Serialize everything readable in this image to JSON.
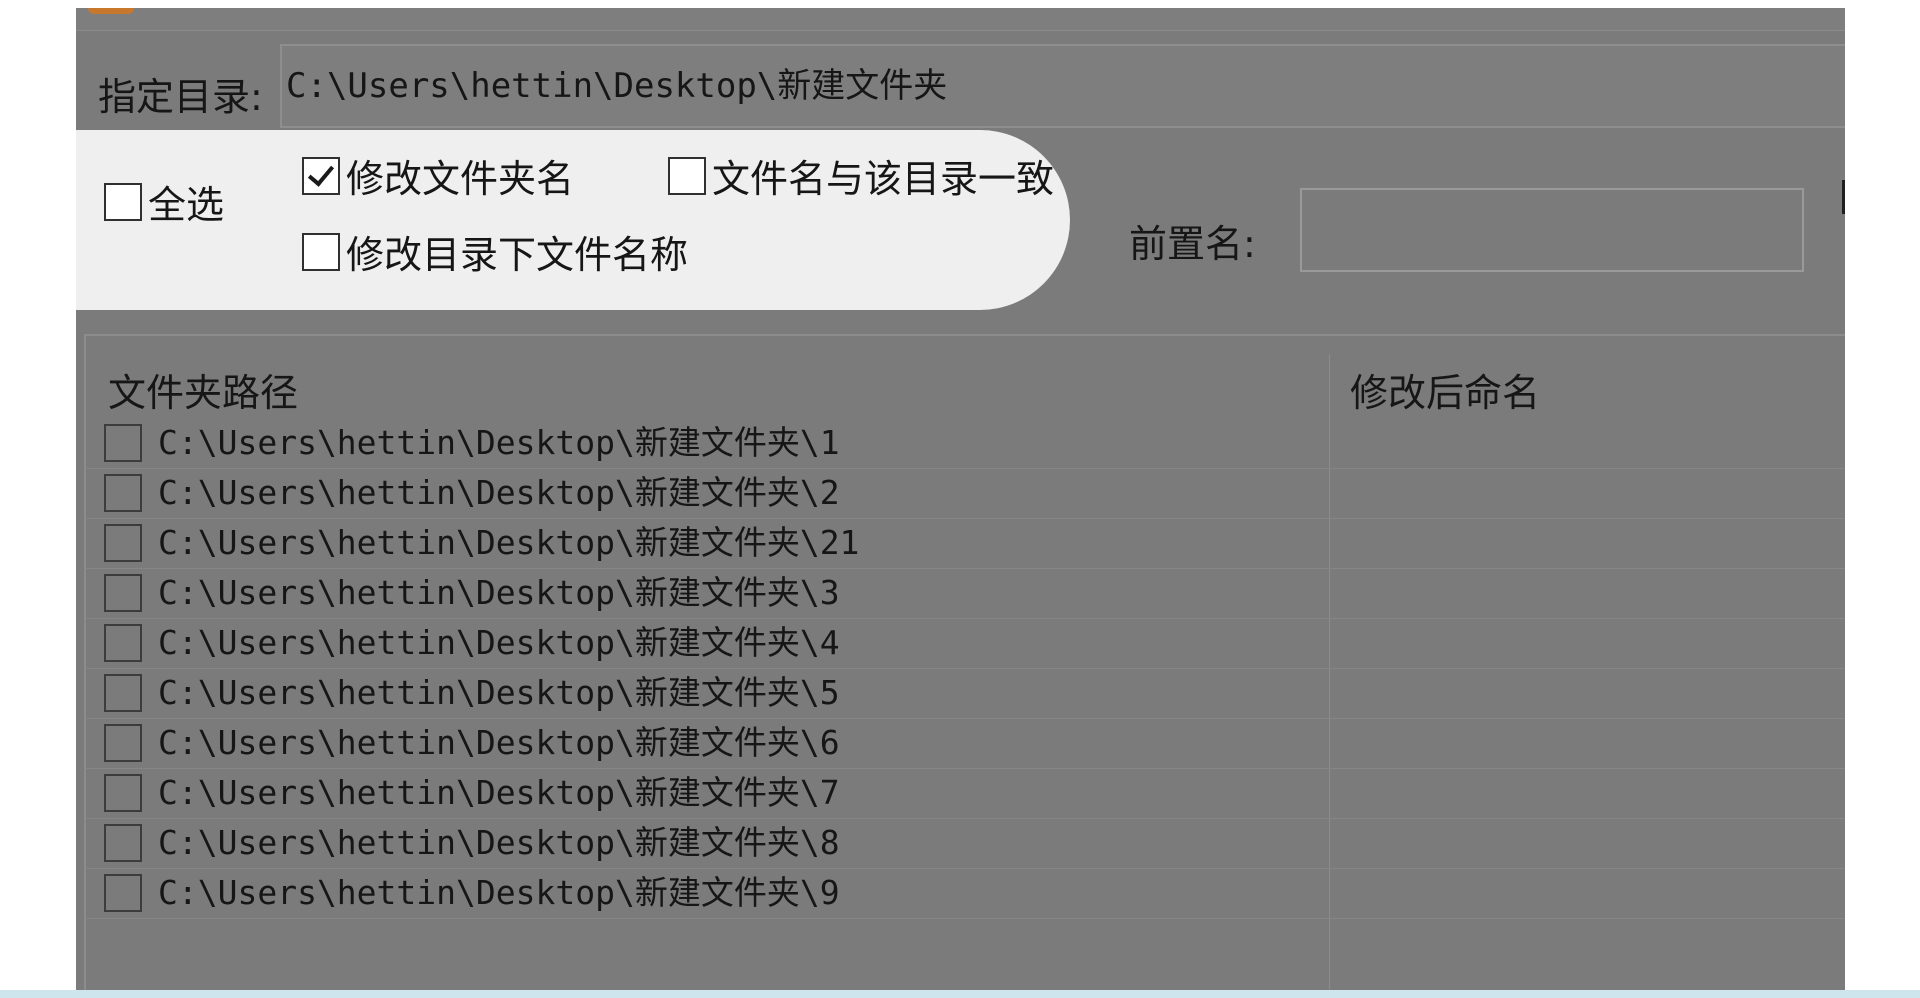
{
  "directory": {
    "label": "指定目录:",
    "value": "C:\\Users\\hettin\\Desktop\\新建文件夹"
  },
  "options": {
    "select_all": {
      "label": "全选",
      "checked": false
    },
    "rename_folder": {
      "label": "修改文件夹名",
      "checked": true
    },
    "match_dir_name": {
      "label": "文件名与该目录一致",
      "checked": false
    },
    "rename_files": {
      "label": "修改目录下文件名称",
      "checked": false
    }
  },
  "prefix": {
    "label": "前置名:",
    "value": ""
  },
  "table": {
    "columns": [
      "文件夹路径",
      "修改后命名"
    ],
    "rows": [
      {
        "path": "C:\\Users\\hettin\\Desktop\\新建文件夹\\1",
        "new_name": ""
      },
      {
        "path": "C:\\Users\\hettin\\Desktop\\新建文件夹\\2",
        "new_name": ""
      },
      {
        "path": "C:\\Users\\hettin\\Desktop\\新建文件夹\\21",
        "new_name": ""
      },
      {
        "path": "C:\\Users\\hettin\\Desktop\\新建文件夹\\3",
        "new_name": ""
      },
      {
        "path": "C:\\Users\\hettin\\Desktop\\新建文件夹\\4",
        "new_name": ""
      },
      {
        "path": "C:\\Users\\hettin\\Desktop\\新建文件夹\\5",
        "new_name": ""
      },
      {
        "path": "C:\\Users\\hettin\\Desktop\\新建文件夹\\6",
        "new_name": ""
      },
      {
        "path": "C:\\Users\\hettin\\Desktop\\新建文件夹\\7",
        "new_name": ""
      },
      {
        "path": "C:\\Users\\hettin\\Desktop\\新建文件夹\\8",
        "new_name": ""
      },
      {
        "path": "C:\\Users\\hettin\\Desktop\\新建文件夹\\9",
        "new_name": ""
      }
    ]
  },
  "colors": {
    "overlay_gray": "#7b7b7b",
    "highlight": "#efefef",
    "text": "#161616"
  }
}
